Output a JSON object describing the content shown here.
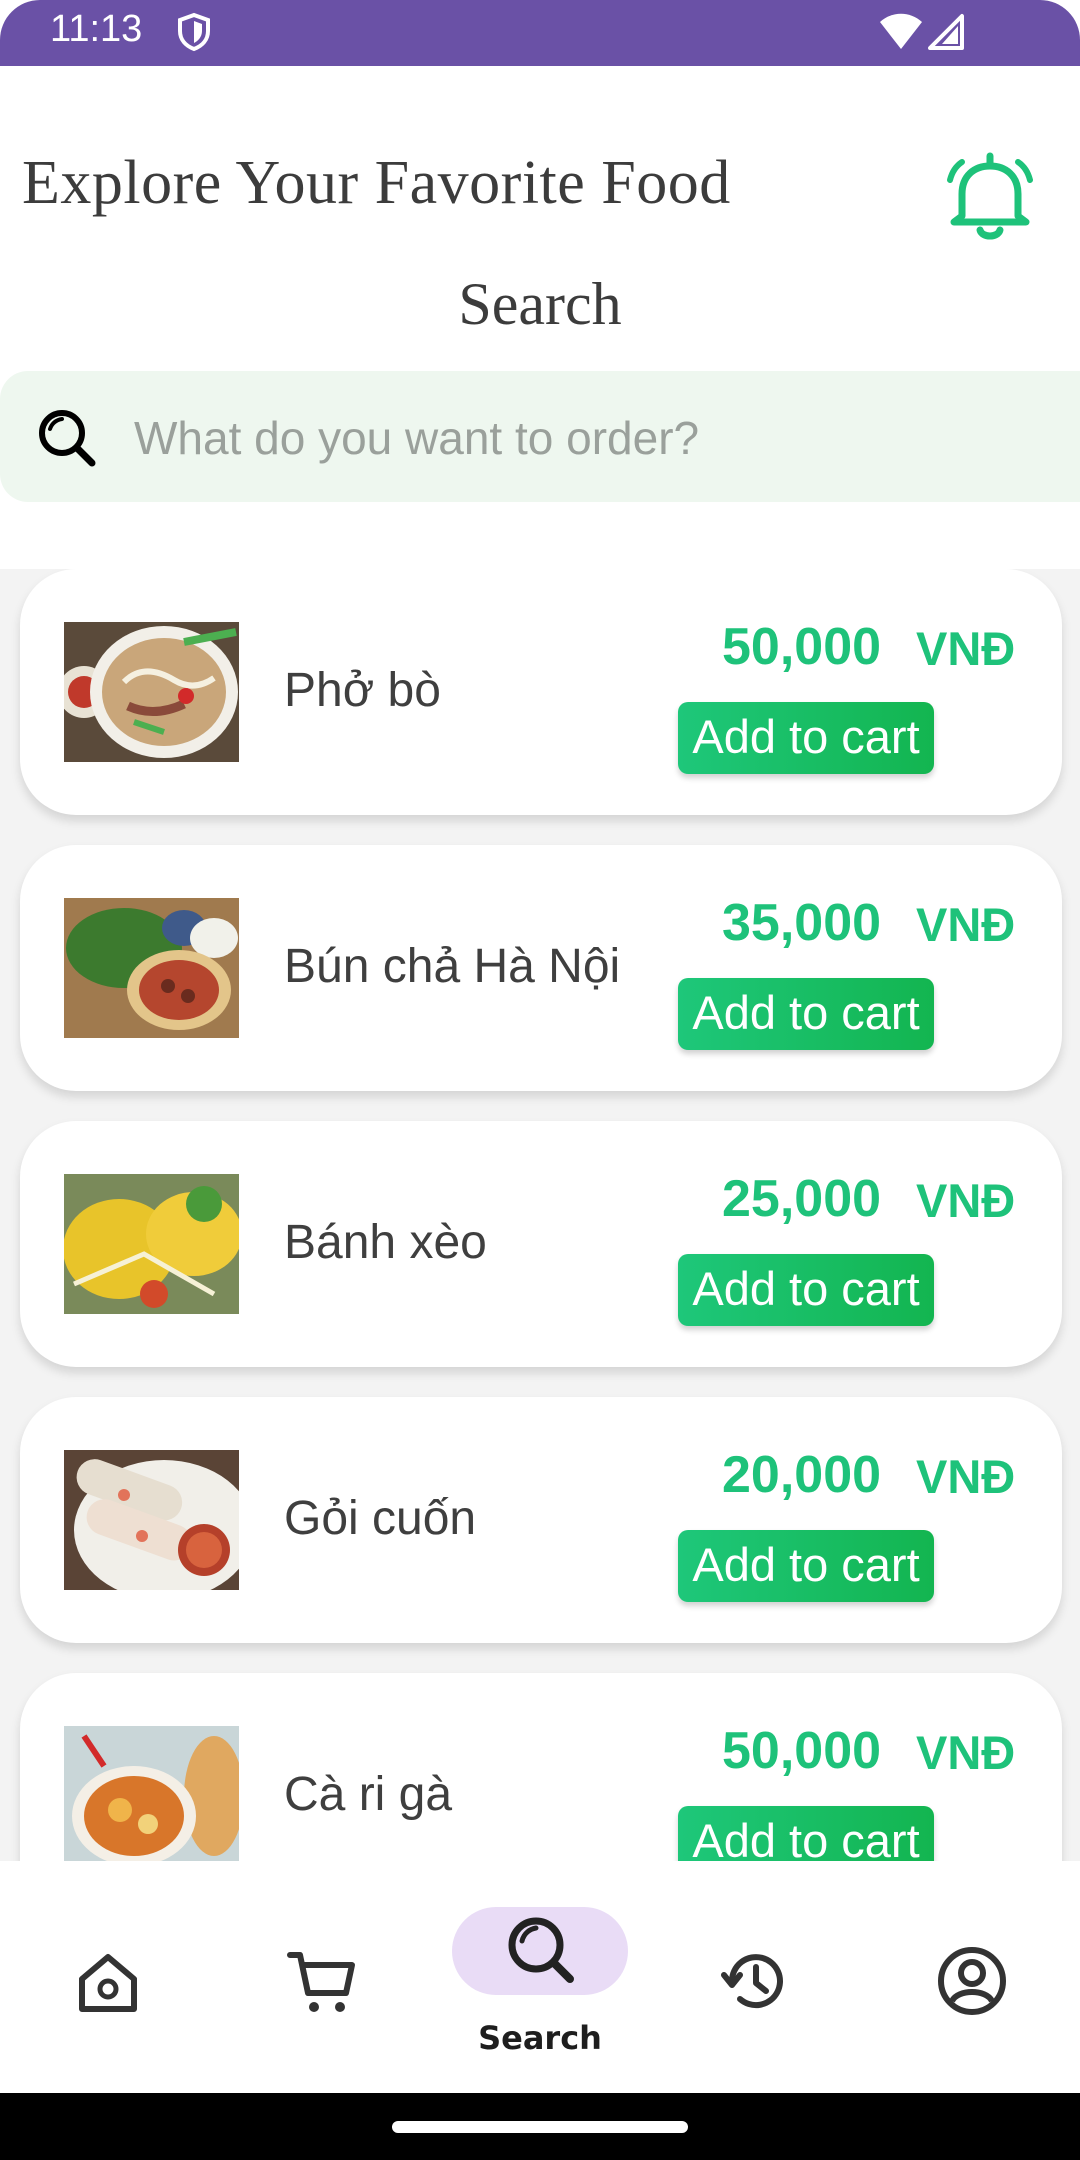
{
  "status_bar": {
    "time": "11:13"
  },
  "header": {
    "title": "Explore Your Favorite Food"
  },
  "section": {
    "title": "Search"
  },
  "search": {
    "placeholder": "What do you want to order?"
  },
  "foods": [
    {
      "name": "Phở bò",
      "price": "50,000",
      "currency": "VNĐ",
      "button": "Add to cart"
    },
    {
      "name": "Bún chả Hà Nội",
      "price": "35,000",
      "currency": "VNĐ",
      "button": "Add to cart"
    },
    {
      "name": "Bánh xèo",
      "price": "25,000",
      "currency": "VNĐ",
      "button": "Add to cart"
    },
    {
      "name": "Gỏi cuốn",
      "price": "20,000",
      "currency": "VNĐ",
      "button": "Add to cart"
    },
    {
      "name": "Cà ri gà",
      "price": "50,000",
      "currency": "VNĐ",
      "button": "Add to cart"
    }
  ],
  "nav": {
    "items": [
      "home-icon",
      "cart-icon",
      "search-icon",
      "history-icon",
      "profile-icon"
    ],
    "active_label": "Search"
  },
  "colors": {
    "accent": "#1ec27a",
    "status_bar": "#6a51a6",
    "nav_pill": "#e9dcf6",
    "search_bg": "#eef7ef"
  }
}
